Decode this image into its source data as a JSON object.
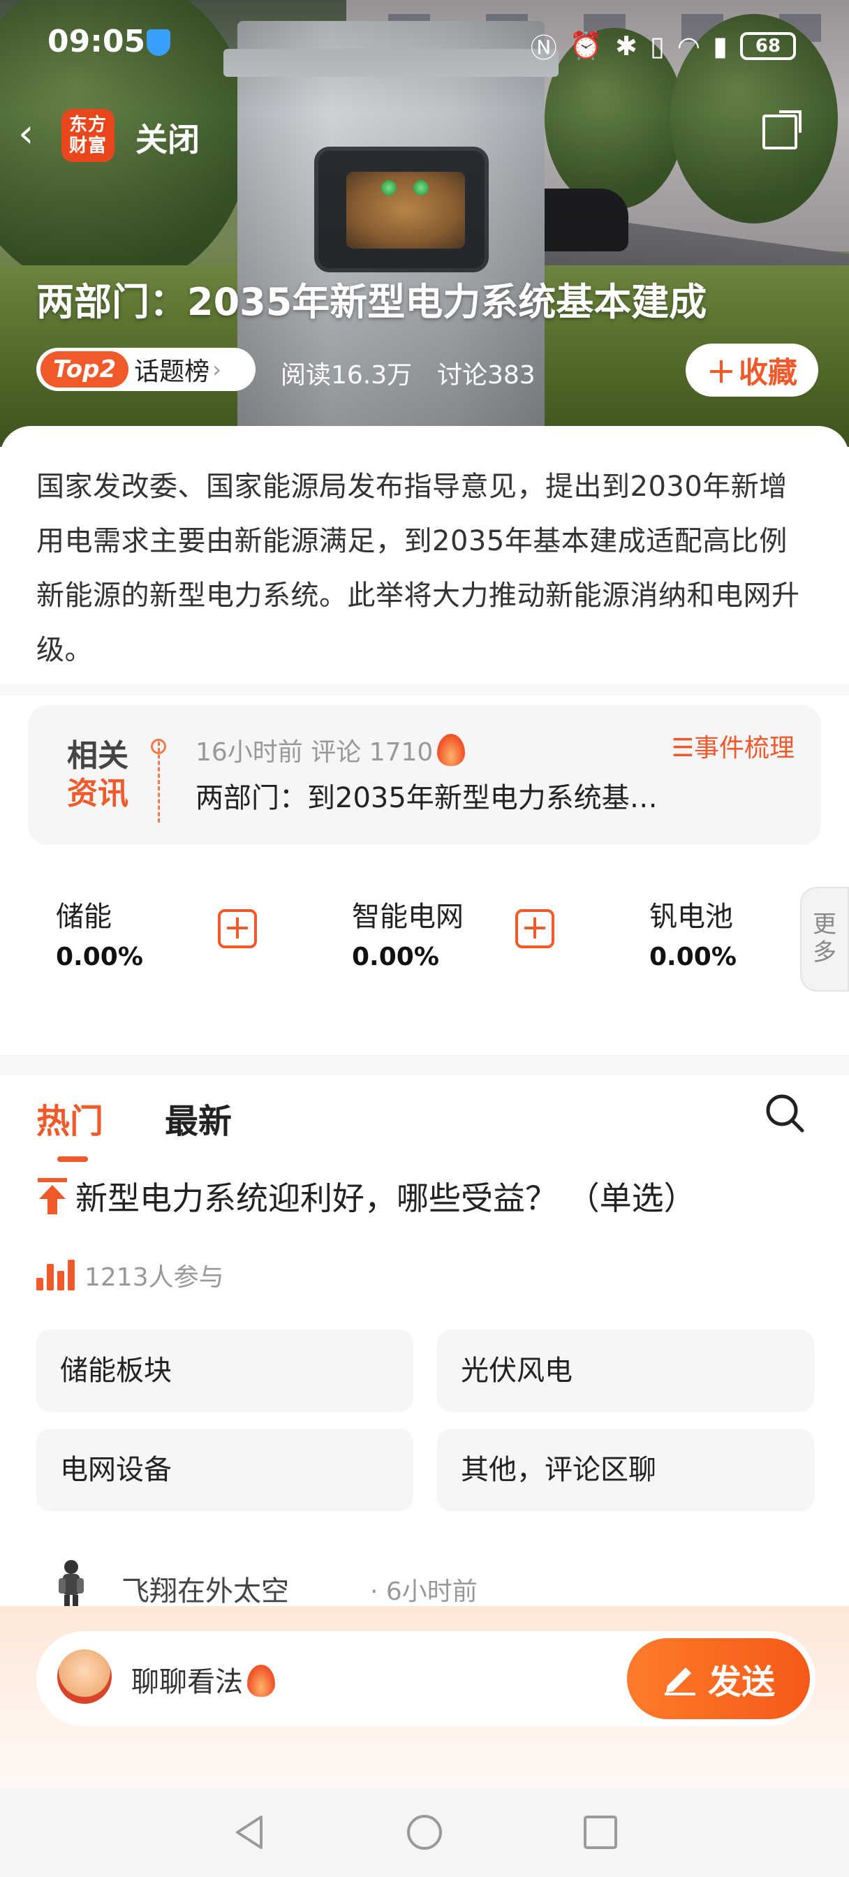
{
  "status_bar": {
    "time": "09:05",
    "battery": "68"
  },
  "topnav": {
    "logo_text_line1": "东方",
    "logo_text_line2": "财富",
    "close_label": "关闭"
  },
  "topic": {
    "title": "两部门：2035年新型电力系统基本建成",
    "rank_badge": "Top2",
    "rank_label": "话题榜",
    "reads": "阅读16.3万",
    "discussions": "讨论383",
    "favorite_label": "收藏",
    "summary": "国家发改委、国家能源局发布指导意见，提出到2030年新增用电需求主要由新能源满足，到2035年基本建成适配高比例新能源的新型电力系统。此举将大力推动新能源消纳和电网升级。"
  },
  "related": {
    "tag_line1": "相关",
    "tag_line2": "资讯",
    "meta": "16小时前  评论 1710",
    "headline": "两部门：到2035年新型电力系统基…",
    "event_button": "事件梳理"
  },
  "stocks": [
    {
      "name": "储能",
      "change": "0.00%"
    },
    {
      "name": "智能电网",
      "change": "0.00%"
    },
    {
      "name": "钒电池",
      "change": "0.00%"
    }
  ],
  "more_label_1": "更",
  "more_label_2": "多",
  "tabs": {
    "hot": "热门",
    "latest": "最新"
  },
  "poll": {
    "question": "新型电力系统迎利好，哪些受益？ （单选）",
    "participants": "1213人参与",
    "options": [
      "储能板块",
      "光伏风电",
      "电网设备",
      "其他，评论区聊"
    ]
  },
  "comment_preview": {
    "username": "飞翔在外太空",
    "time": "· 6小时前"
  },
  "input_bar": {
    "placeholder": "聊聊看法",
    "send_label": "发送"
  },
  "colors": {
    "accent": "#f05a2a",
    "text_primary": "#222222",
    "text_secondary": "#999999"
  }
}
